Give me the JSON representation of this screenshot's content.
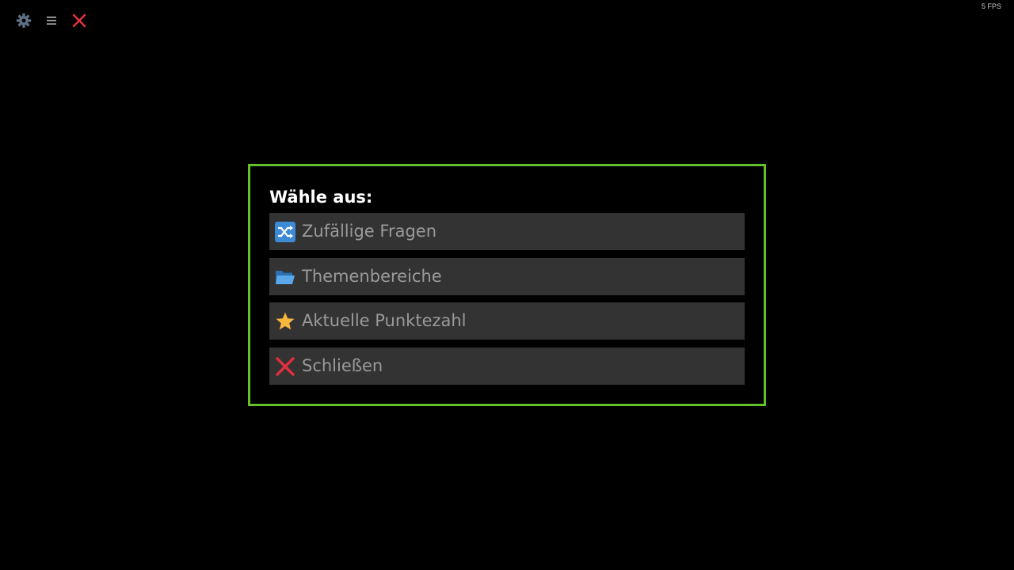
{
  "toolbar": {
    "icons": [
      "gear-icon",
      "hamburger-menu-icon",
      "close-icon"
    ],
    "colors": {
      "gear": "#5f7285",
      "menu": "#c8c8c8",
      "close": "#e0323d"
    }
  },
  "fps_counter": "5 FPS",
  "menu": {
    "title": "Wähle aus:",
    "border_color": "#63c22c",
    "item_background": "#333333",
    "items": [
      {
        "label": "Zufällige Fragen",
        "icon": "shuffle-icon"
      },
      {
        "label": "Themenbereiche",
        "icon": "folder-icon"
      },
      {
        "label": "Aktuelle Punktezahl",
        "icon": "star-icon"
      },
      {
        "label": "Schließen",
        "icon": "cross-mark-icon"
      }
    ]
  }
}
